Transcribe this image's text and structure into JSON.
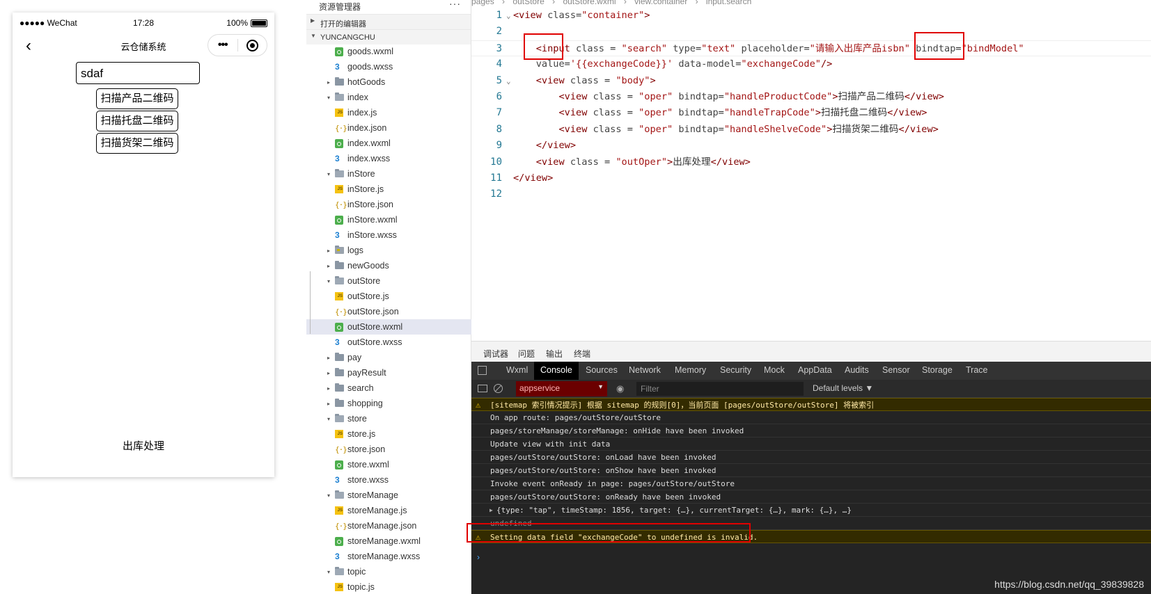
{
  "simulator": {
    "status_signal": "●●●●● WeChat",
    "status_time": "17:28",
    "status_battery": "100%",
    "nav_back_icon": "chevron-left-icon",
    "nav_title": "云仓储系统",
    "capsule_more": "•••",
    "input_value": "sdaf",
    "buttons": [
      "扫描产品二维码",
      "扫描托盘二维码",
      "扫描货架二维码"
    ],
    "out_oper": "出库处理"
  },
  "explorer": {
    "title": "资源管理器",
    "more": "···",
    "open_editors": "打开的编辑器",
    "project": "YUNCANGCHU",
    "tree": [
      {
        "label": "goods.wxml",
        "type": "wxml",
        "depth": 2
      },
      {
        "label": "goods.wxss",
        "type": "wxss",
        "depth": 2
      },
      {
        "label": "hotGoods",
        "type": "folder",
        "depth": 1,
        "twisty": "▸"
      },
      {
        "label": "index",
        "type": "folder",
        "depth": 1,
        "twisty": "▾"
      },
      {
        "label": "index.js",
        "type": "js",
        "depth": 2
      },
      {
        "label": "index.json",
        "type": "json",
        "depth": 2
      },
      {
        "label": "index.wxml",
        "type": "wxml",
        "depth": 2
      },
      {
        "label": "index.wxss",
        "type": "wxss",
        "depth": 2
      },
      {
        "label": "inStore",
        "type": "folder",
        "depth": 1,
        "twisty": "▾"
      },
      {
        "label": "inStore.js",
        "type": "js",
        "depth": 2
      },
      {
        "label": "inStore.json",
        "type": "json",
        "depth": 2
      },
      {
        "label": "inStore.wxml",
        "type": "wxml",
        "depth": 2
      },
      {
        "label": "inStore.wxss",
        "type": "wxss",
        "depth": 2
      },
      {
        "label": "logs",
        "type": "logs",
        "depth": 1,
        "twisty": "▸"
      },
      {
        "label": "newGoods",
        "type": "folder",
        "depth": 1,
        "twisty": "▸"
      },
      {
        "label": "outStore",
        "type": "folder",
        "depth": 1,
        "twisty": "▾"
      },
      {
        "label": "outStore.js",
        "type": "js",
        "depth": 2
      },
      {
        "label": "outStore.json",
        "type": "json",
        "depth": 2
      },
      {
        "label": "outStore.wxml",
        "type": "wxml",
        "depth": 2,
        "selected": true
      },
      {
        "label": "outStore.wxss",
        "type": "wxss",
        "depth": 2
      },
      {
        "label": "pay",
        "type": "folder",
        "depth": 1,
        "twisty": "▸"
      },
      {
        "label": "payResult",
        "type": "folder",
        "depth": 1,
        "twisty": "▸"
      },
      {
        "label": "search",
        "type": "folder",
        "depth": 1,
        "twisty": "▸"
      },
      {
        "label": "shopping",
        "type": "folder",
        "depth": 1,
        "twisty": "▸"
      },
      {
        "label": "store",
        "type": "folder",
        "depth": 1,
        "twisty": "▾"
      },
      {
        "label": "store.js",
        "type": "js",
        "depth": 2
      },
      {
        "label": "store.json",
        "type": "json",
        "depth": 2
      },
      {
        "label": "store.wxml",
        "type": "wxml",
        "depth": 2
      },
      {
        "label": "store.wxss",
        "type": "wxss",
        "depth": 2
      },
      {
        "label": "storeManage",
        "type": "folder",
        "depth": 1,
        "twisty": "▾"
      },
      {
        "label": "storeManage.js",
        "type": "js",
        "depth": 2
      },
      {
        "label": "storeManage.json",
        "type": "json",
        "depth": 2
      },
      {
        "label": "storeManage.wxml",
        "type": "wxml",
        "depth": 2
      },
      {
        "label": "storeManage.wxss",
        "type": "wxss",
        "depth": 2
      },
      {
        "label": "topic",
        "type": "folder",
        "depth": 1,
        "twisty": "▾"
      },
      {
        "label": "topic.js",
        "type": "js",
        "depth": 2
      }
    ]
  },
  "editor": {
    "breadcrumb": [
      "pages",
      "outStore",
      "outStore.wxml",
      "view.container",
      "input.search"
    ],
    "line_numbers": [
      "1",
      "2",
      "3",
      "4",
      "5",
      "6",
      "7",
      "8",
      "9",
      "10",
      "11",
      "12"
    ]
  },
  "devtools": {
    "tabs": [
      "调试器",
      "问题",
      "输出",
      "终端"
    ],
    "panels": [
      "Wxml",
      "Console",
      "Sources",
      "Network",
      "Memory",
      "Security",
      "Mock",
      "AppData",
      "Audits",
      "Sensor",
      "Storage",
      "Trace"
    ],
    "context": "appservice",
    "filter_placeholder": "Filter",
    "levels": "Default levels ▼",
    "logs": [
      {
        "text": "[sitemap 索引情况提示] 根据 sitemap 的规则[0]，当前页面 [pages/outStore/outStore] 将被索引",
        "kind": "warn"
      },
      {
        "text": "On app route: pages/outStore/outStore",
        "kind": "log"
      },
      {
        "text": "pages/storeManage/storeManage: onHide have been invoked",
        "kind": "log"
      },
      {
        "text": "Update view with init data",
        "kind": "log"
      },
      {
        "text": "pages/outStore/outStore: onLoad have been invoked",
        "kind": "log"
      },
      {
        "text": "pages/outStore/outStore: onShow have been invoked",
        "kind": "log"
      },
      {
        "text": "Invoke event onReady in page: pages/outStore/outStore",
        "kind": "log"
      },
      {
        "text": "pages/outStore/outStore: onReady have been invoked",
        "kind": "log"
      },
      {
        "text": "{type: \"tap\", timeStamp: 1856, target: {…}, currentTarget: {…}, mark: {…}, …}",
        "kind": "object"
      },
      {
        "text": "undefined",
        "kind": "dim"
      },
      {
        "text": "Setting data field \"exchangeCode\" to undefined is invalid.",
        "kind": "warn"
      }
    ],
    "watermark": "https://blog.csdn.net/qq_39839828"
  }
}
